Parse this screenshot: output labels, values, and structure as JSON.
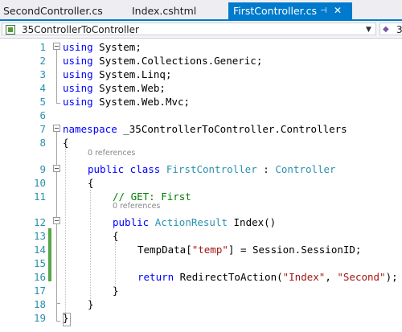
{
  "tabs": [
    {
      "label": "SecondController.cs",
      "active": false
    },
    {
      "label": "Index.cshtml",
      "active": false
    },
    {
      "label": "FirstController.cs",
      "active": true
    }
  ],
  "tab_icons": {
    "pin": "pin-icon",
    "close": "close-icon"
  },
  "navbar": {
    "project_combo": "_35ControllerToController",
    "member_combo": "_3",
    "icon": "csharp-project-icon"
  },
  "colors": {
    "accent": "#007acc",
    "keyword": "#0000ff",
    "type": "#2b91af",
    "string": "#a31515",
    "comment": "#008000",
    "change_bar": "#57a64a",
    "references": "#888888"
  },
  "code": {
    "lines": [
      {
        "n": "1",
        "t": [
          {
            "c": "kw",
            "s": "using"
          },
          {
            "c": "",
            "s": " System;"
          }
        ]
      },
      {
        "n": "2",
        "t": [
          {
            "c": "kw",
            "s": "using"
          },
          {
            "c": "",
            "s": " System.Collections.Generic;"
          }
        ]
      },
      {
        "n": "3",
        "t": [
          {
            "c": "kw",
            "s": "using"
          },
          {
            "c": "",
            "s": " System.Linq;"
          }
        ]
      },
      {
        "n": "4",
        "t": [
          {
            "c": "kw",
            "s": "using"
          },
          {
            "c": "",
            "s": " System.Web;"
          }
        ]
      },
      {
        "n": "5",
        "t": [
          {
            "c": "kw",
            "s": "using"
          },
          {
            "c": "",
            "s": " System.Web.Mvc;"
          }
        ]
      },
      {
        "n": "6",
        "t": []
      },
      {
        "n": "7",
        "t": [
          {
            "c": "kw",
            "s": "namespace"
          },
          {
            "c": "",
            "s": " _35ControllerToController.Controllers"
          }
        ]
      },
      {
        "n": "8",
        "t": [
          {
            "c": "",
            "s": "{"
          }
        ]
      },
      {
        "n": "9",
        "t": [
          {
            "c": "kw",
            "s": "public class"
          },
          {
            "c": "",
            "s": " "
          },
          {
            "c": "ty",
            "s": "FirstController"
          },
          {
            "c": "",
            "s": " : "
          },
          {
            "c": "ty",
            "s": "Controller"
          }
        ]
      },
      {
        "n": "10",
        "t": [
          {
            "c": "",
            "s": "{"
          }
        ]
      },
      {
        "n": "11",
        "t": [
          {
            "c": "cm",
            "s": "// GET: First"
          }
        ]
      },
      {
        "n": "12",
        "t": [
          {
            "c": "kw",
            "s": "public"
          },
          {
            "c": "",
            "s": " "
          },
          {
            "c": "ty",
            "s": "ActionResult"
          },
          {
            "c": "",
            "s": " Index()"
          }
        ]
      },
      {
        "n": "13",
        "t": [
          {
            "c": "",
            "s": "{"
          }
        ]
      },
      {
        "n": "14",
        "t": [
          {
            "c": "",
            "s": "TempData["
          },
          {
            "c": "st",
            "s": "\"temp\""
          },
          {
            "c": "",
            "s": "] = Session.SessionID;"
          }
        ]
      },
      {
        "n": "15",
        "t": []
      },
      {
        "n": "16",
        "t": [
          {
            "c": "kw",
            "s": "return"
          },
          {
            "c": "",
            "s": " RedirectToAction("
          },
          {
            "c": "st",
            "s": "\"Index\""
          },
          {
            "c": "",
            "s": ", "
          },
          {
            "c": "st",
            "s": "\"Second\""
          },
          {
            "c": "",
            "s": ");"
          }
        ]
      },
      {
        "n": "17",
        "t": [
          {
            "c": "",
            "s": "}"
          }
        ]
      },
      {
        "n": "18",
        "t": [
          {
            "c": "",
            "s": "}"
          }
        ]
      },
      {
        "n": "19",
        "t": [
          {
            "c": "",
            "s": "}"
          }
        ]
      }
    ],
    "references": [
      "0 references",
      "0 references"
    ]
  }
}
